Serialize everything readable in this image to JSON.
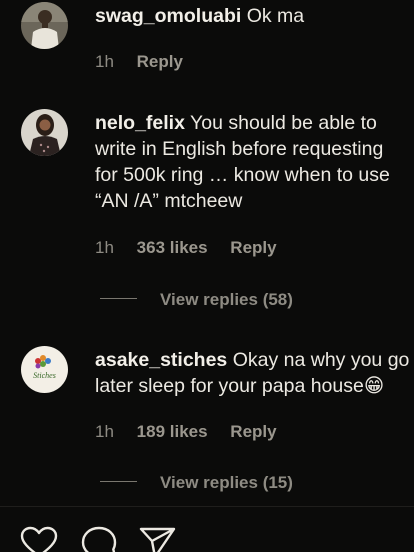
{
  "comments": [
    {
      "username": "swag_omoluabi",
      "text": "Ok ma",
      "time": "1h",
      "likes": "",
      "reply_label": "Reply",
      "avatar_icon": "profile-photo-man"
    },
    {
      "username": "nelo_felix",
      "text": "You should be able to write in English before requesting for 500k ring … know when to use “AN /A” mtcheew",
      "time": "1h",
      "likes": "363 likes",
      "reply_label": "Reply",
      "view_replies": "View replies (58)",
      "avatar_icon": "profile-photo-woman"
    },
    {
      "username": "asake_stiches",
      "text": "Okay na why you go later sleep for your papa house😁",
      "time": "1h",
      "likes": "189 likes",
      "reply_label": "Reply",
      "view_replies": "View replies (15)",
      "avatar_icon": "stiches-logo",
      "avatar_text": "Stiches"
    }
  ],
  "actions": {
    "like_icon": "heart-icon",
    "comment_icon": "comment-icon",
    "share_icon": "send-icon"
  },
  "colors": {
    "background": "#0b0b0a",
    "text": "#ece9e2",
    "meta": "#8e8b83"
  }
}
